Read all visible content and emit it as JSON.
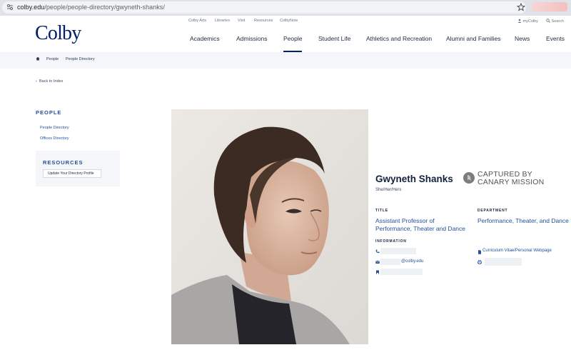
{
  "browser": {
    "url_host": "colby.edu",
    "url_path": "/people/people-directory/gwyneth-shanks/"
  },
  "utility_nav": {
    "items": [
      "Colby Arts",
      "Libraries",
      "Visit",
      "Resources",
      "ColbyNow"
    ],
    "mycolby": "myColby",
    "search": "Search"
  },
  "logo": "Colby",
  "main_nav": {
    "items": [
      "Academics",
      "Admissions",
      "People",
      "Student Life",
      "Athletics and Recreation",
      "Alumni and Families",
      "News",
      "Events"
    ],
    "active": "People"
  },
  "breadcrumb": [
    "People",
    "People Directory"
  ],
  "back_link": "Back to Index",
  "sidebar": {
    "title": "PEOPLE",
    "links": [
      "People Directory",
      "Offices Directory"
    ],
    "resources_title": "RESOURCES",
    "resources_button": "Update Your Directory Profile"
  },
  "profile": {
    "name": "Gwyneth Shanks",
    "pronouns": "She/Her/Hers",
    "title_label": "TITLE",
    "title_value": "Assistant Professor of Performance, Theater and Dance",
    "department_label": "DEPARTMENT",
    "department_value": "Performance, Theater, and Dance",
    "information_label": "INFORMATION",
    "email_suffix": "@colby.edu",
    "cv_link": "Curriculum Vitae/Personal Webpage"
  },
  "badge": {
    "line1": "CAPTURED BY",
    "line2": "CANARY MISSION"
  },
  "colors": {
    "brand_navy": "#002169",
    "link_blue": "#25509b"
  }
}
